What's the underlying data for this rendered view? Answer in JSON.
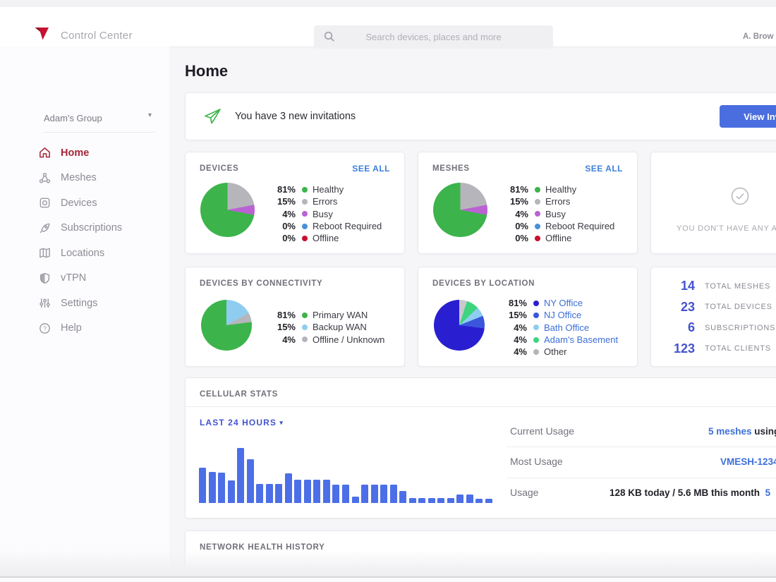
{
  "header": {
    "app_title": "Control Center",
    "search_placeholder": "Search devices, places and more",
    "user_label": "A. Brow"
  },
  "sidebar": {
    "group_selector": "Adam's Group",
    "items": [
      {
        "label": "Home",
        "icon": "home-icon",
        "active": true
      },
      {
        "label": "Meshes",
        "icon": "meshes-icon",
        "active": false
      },
      {
        "label": "Devices",
        "icon": "devices-icon",
        "active": false
      },
      {
        "label": "Subscriptions",
        "icon": "subscriptions-icon",
        "active": false
      },
      {
        "label": "Locations",
        "icon": "locations-icon",
        "active": false
      },
      {
        "label": "vTPN",
        "icon": "vtpn-icon",
        "active": false
      },
      {
        "label": "Settings",
        "icon": "settings-icon",
        "active": false
      },
      {
        "label": "Help",
        "icon": "help-icon",
        "active": false
      }
    ]
  },
  "main": {
    "page_title": "Home",
    "banner": {
      "message": "You have 3 new invitations",
      "button_label": "View Inv",
      "icon": "paper-plane-icon"
    },
    "devices_card": {
      "title": "DEVICES",
      "see_all": "SEE ALL"
    },
    "meshes_card": {
      "title": "MESHES",
      "see_all": "SEE ALL"
    },
    "alerts_card": {
      "message": "YOU DON'T HAVE ANY A",
      "icon": "check-circle-icon"
    },
    "connectivity_card": {
      "title": "DEVICES BY CONNECTIVITY"
    },
    "location_card": {
      "title": "DEVICES BY LOCATION"
    },
    "totals_card": {
      "rows": [
        {
          "value": "14",
          "label": "TOTAL MESHES"
        },
        {
          "value": "23",
          "label": "TOTAL DEVICES"
        },
        {
          "value": "6",
          "label": "SUBSCRIPTIONS"
        },
        {
          "value": "123",
          "label": "TOTAL CLIENTS"
        }
      ]
    },
    "cellular_card": {
      "title": "CELLULAR STATS",
      "range_selector": "LAST 24 HOURS",
      "rows": [
        {
          "label": "Current Usage",
          "link": "5 meshes",
          "text": " using"
        },
        {
          "label": "Most Usage",
          "link": "VMESH-1234",
          "text": ""
        },
        {
          "label": "Usage",
          "text": "128 KB today / 5.6 MB this month",
          "link": "5"
        }
      ]
    },
    "network_card": {
      "title": "NETWORK HEALTH HISTORY"
    }
  },
  "colors": {
    "brand_red": "#c41230",
    "active_nav_red": "#a32638",
    "accent_button_blue": "#4a6ee0",
    "link_blue": "#3d7fd9",
    "totals_blue": "#4453cd",
    "bar_blue": "#4c6fe7"
  },
  "chart_data": [
    {
      "id": "devices-pie",
      "type": "pie",
      "title": "DEVICES",
      "legend_position": "right",
      "slices": [
        {
          "label": "Healthy",
          "pct": 81,
          "pct_label": "81%",
          "color": "#3cb44b"
        },
        {
          "label": "Errors",
          "pct": 15,
          "pct_label": "15%",
          "color": "#b6b5bb"
        },
        {
          "label": "Busy",
          "pct": 4,
          "pct_label": "4%",
          "color": "#ba62d4"
        },
        {
          "label": "Reboot Required",
          "pct": 0,
          "pct_label": "0%",
          "color": "#4a90d9"
        },
        {
          "label": "Offline",
          "pct": 0,
          "pct_label": "0%",
          "color": "#c8102e"
        }
      ],
      "draw_slices": [
        [
          "#b6b5bb",
          22
        ],
        [
          "#ba62d4",
          6
        ],
        [
          "#3cb44b",
          72
        ]
      ]
    },
    {
      "id": "meshes-pie",
      "type": "pie",
      "title": "MESHES",
      "legend_position": "right",
      "slices": [
        {
          "label": "Healthy",
          "pct": 81,
          "pct_label": "81%",
          "color": "#3cb44b"
        },
        {
          "label": "Errors",
          "pct": 15,
          "pct_label": "15%",
          "color": "#b6b5bb"
        },
        {
          "label": "Busy",
          "pct": 4,
          "pct_label": "4%",
          "color": "#ba62d4"
        },
        {
          "label": "Reboot Required",
          "pct": 0,
          "pct_label": "0%",
          "color": "#4a90d9"
        },
        {
          "label": "Offline",
          "pct": 0,
          "pct_label": "0%",
          "color": "#c8102e"
        }
      ],
      "draw_slices": [
        [
          "#b6b5bb",
          22
        ],
        [
          "#ba62d4",
          6
        ],
        [
          "#3cb44b",
          72
        ]
      ]
    },
    {
      "id": "connectivity-pie",
      "type": "pie",
      "title": "DEVICES BY CONNECTIVITY",
      "legend_position": "right",
      "slices": [
        {
          "label": "Primary WAN",
          "pct": 81,
          "pct_label": "81%",
          "color": "#3cb44b"
        },
        {
          "label": "Backup WAN",
          "pct": 15,
          "pct_label": "15%",
          "color": "#8ecdf0"
        },
        {
          "label": "Offline / Unknown",
          "pct": 4,
          "pct_label": "4%",
          "color": "#b6b5bb"
        }
      ],
      "draw_slices": [
        [
          "#8ecdf0",
          17
        ],
        [
          "#b6b5bb",
          6
        ],
        [
          "#3cb44b",
          77
        ]
      ]
    },
    {
      "id": "location-pie",
      "type": "pie",
      "title": "DEVICES BY LOCATION",
      "legend_position": "right",
      "slices": [
        {
          "label": "NY Office",
          "pct": 81,
          "pct_label": "81%",
          "color": "#2a1fd0",
          "link": true
        },
        {
          "label": "NJ Office",
          "pct": 15,
          "pct_label": "15%",
          "color": "#3b56dd",
          "link": true
        },
        {
          "label": "Bath Office",
          "pct": 4,
          "pct_label": "4%",
          "color": "#8ecdf0",
          "link": true
        },
        {
          "label": "Adam's Basement",
          "pct": 4,
          "pct_label": "4%",
          "color": "#3ed47e",
          "link": true
        },
        {
          "label": "Other",
          "pct": 4,
          "pct_label": "4%",
          "color": "#b6b5bb",
          "link": false
        }
      ],
      "draw_slices": [
        [
          "#c9c8ce",
          5
        ],
        [
          "#3ed47e",
          8
        ],
        [
          "#8ecdf0",
          6
        ],
        [
          "#3b56dd",
          8
        ],
        [
          "#2a1fd0",
          73
        ]
      ]
    },
    {
      "id": "cellular-usage",
      "type": "bar",
      "title": "CELLULAR STATS",
      "period": "LAST 24 HOURS",
      "xlabel": "",
      "ylabel": "",
      "axis_labels_shown": false,
      "grid": false,
      "unit": "relative usage, % of tallest bar",
      "color": "#4c6fe7",
      "values": [
        64,
        56,
        55,
        41,
        100,
        79,
        34,
        34,
        34,
        54,
        42,
        42,
        42,
        42,
        33,
        33,
        11,
        33,
        33,
        33,
        33,
        22,
        9,
        9,
        9,
        9,
        9,
        15,
        15,
        8,
        8
      ]
    }
  ]
}
